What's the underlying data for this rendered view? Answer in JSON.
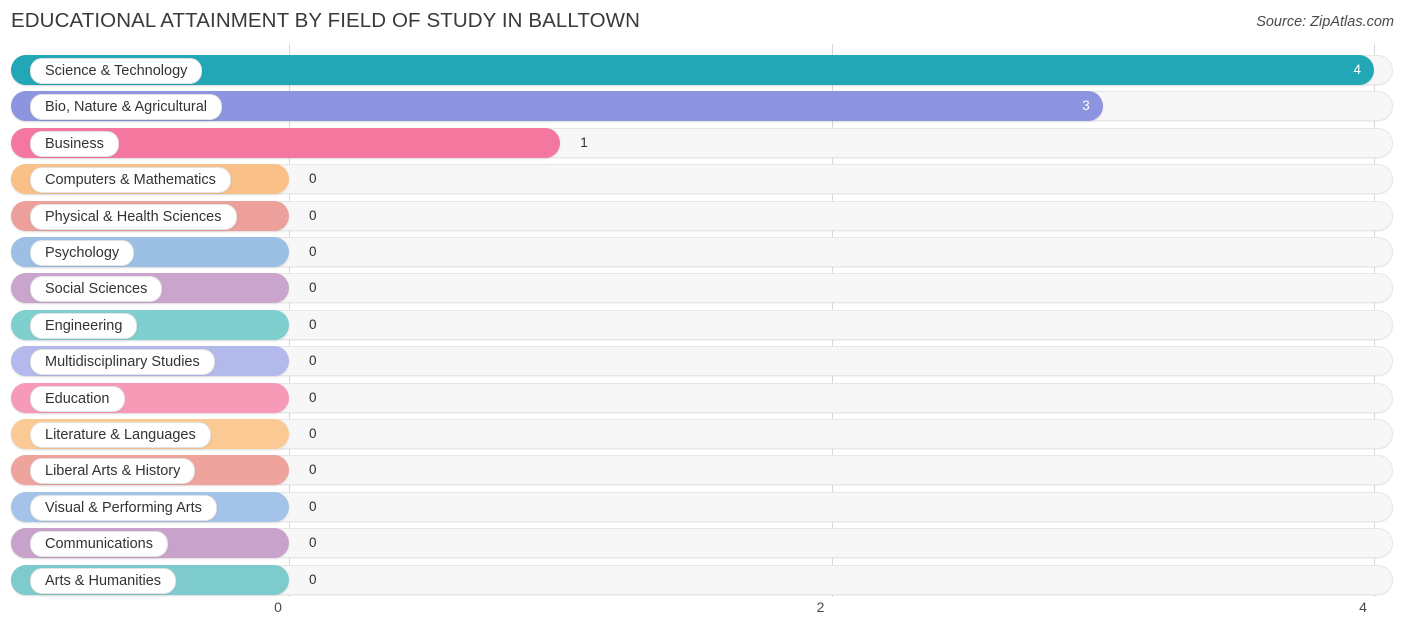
{
  "header": {
    "title": "EDUCATIONAL ATTAINMENT BY FIELD OF STUDY IN BALLTOWN",
    "source": "Source: ZipAtlas.com"
  },
  "chart_data": {
    "type": "bar",
    "orientation": "horizontal",
    "title": "EDUCATIONAL ATTAINMENT BY FIELD OF STUDY IN BALLTOWN",
    "xlabel": "",
    "ylabel": "",
    "xlim": [
      0,
      4
    ],
    "grid": true,
    "legend": "none",
    "xticks": [
      "0",
      "2",
      "4"
    ],
    "xtick_values": [
      0,
      2,
      4
    ],
    "categories": [
      "Science & Technology",
      "Bio, Nature & Agricultural",
      "Business",
      "Computers & Mathematics",
      "Physical & Health Sciences",
      "Psychology",
      "Social Sciences",
      "Engineering",
      "Multidisciplinary Studies",
      "Education",
      "Literature & Languages",
      "Liberal Arts & History",
      "Visual & Performing Arts",
      "Communications",
      "Arts & Humanities"
    ],
    "values": [
      4,
      3,
      1,
      0,
      0,
      0,
      0,
      0,
      0,
      0,
      0,
      0,
      0,
      0,
      0
    ],
    "value_labels": [
      "4",
      "3",
      "1",
      "0",
      "0",
      "0",
      "0",
      "0",
      "0",
      "0",
      "0",
      "0",
      "0",
      "0",
      "0"
    ],
    "colors": [
      "#21a7b5",
      "#8d94e0",
      "#f4779f",
      "#f9c088",
      "#eda09b",
      "#9cc0e4",
      "#c9a5cd",
      "#7fcfce",
      "#b3b9ea",
      "#f79ab8",
      "#fbca94",
      "#efa39d",
      "#a4c3e8",
      "#c9a2cb",
      "#7ecbcd"
    ]
  },
  "bars": [
    {
      "label": "Science & Technology",
      "value": 4,
      "value_label": "4",
      "color": "#21a7b5",
      "inside": true
    },
    {
      "label": "Bio, Nature & Agricultural",
      "value": 3,
      "value_label": "3",
      "color": "#8d94e0",
      "inside": true
    },
    {
      "label": "Business",
      "value": 1,
      "value_label": "1",
      "color": "#f4779f",
      "inside": false
    },
    {
      "label": "Computers & Mathematics",
      "value": 0,
      "value_label": "0",
      "color": "#f9c088",
      "inside": false
    },
    {
      "label": "Physical & Health Sciences",
      "value": 0,
      "value_label": "0",
      "color": "#eda09b",
      "inside": false
    },
    {
      "label": "Psychology",
      "value": 0,
      "value_label": "0",
      "color": "#9cc0e4",
      "inside": false
    },
    {
      "label": "Social Sciences",
      "value": 0,
      "value_label": "0",
      "color": "#c9a5cd",
      "inside": false
    },
    {
      "label": "Engineering",
      "value": 0,
      "value_label": "0",
      "color": "#7fcfce",
      "inside": false
    },
    {
      "label": "Multidisciplinary Studies",
      "value": 0,
      "value_label": "0",
      "color": "#b3b9ea",
      "inside": false
    },
    {
      "label": "Education",
      "value": 0,
      "value_label": "0",
      "color": "#f79ab8",
      "inside": false
    },
    {
      "label": "Literature & Languages",
      "value": 0,
      "value_label": "0",
      "color": "#fbca94",
      "inside": false
    },
    {
      "label": "Liberal Arts & History",
      "value": 0,
      "value_label": "0",
      "color": "#efa39d",
      "inside": false
    },
    {
      "label": "Visual & Performing Arts",
      "value": 0,
      "value_label": "0",
      "color": "#a4c3e8",
      "inside": false
    },
    {
      "label": "Communications",
      "value": 0,
      "value_label": "0",
      "color": "#c9a2cb",
      "inside": false
    },
    {
      "label": "Arts & Humanities",
      "value": 0,
      "value_label": "0",
      "color": "#7ecbcd",
      "inside": false
    }
  ],
  "axis": {
    "ticks": [
      {
        "label": "0",
        "value": 0
      },
      {
        "label": "2",
        "value": 2
      },
      {
        "label": "4",
        "value": 4
      }
    ]
  }
}
